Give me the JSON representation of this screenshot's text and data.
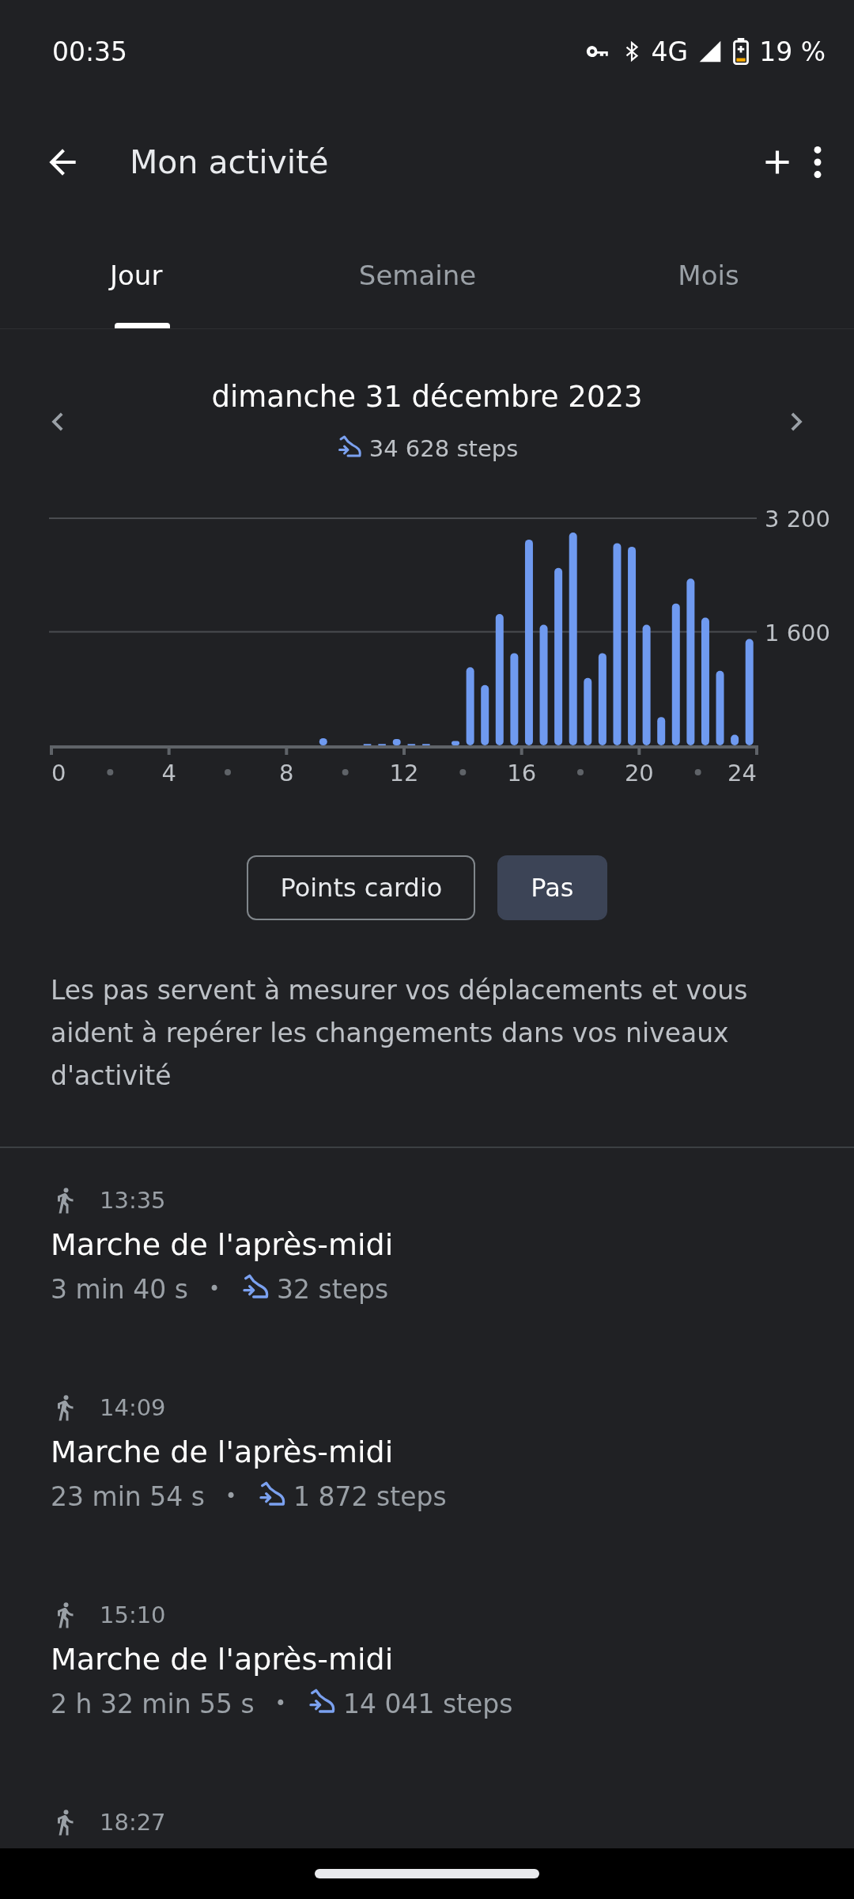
{
  "status_bar": {
    "time": "00:35",
    "network": "4G",
    "battery": "19 %"
  },
  "app_bar": {
    "title": "Mon activité"
  },
  "tabs": [
    {
      "label": "Jour",
      "selected": true
    },
    {
      "label": "Semaine",
      "selected": false
    },
    {
      "label": "Mois",
      "selected": false
    }
  ],
  "day": {
    "date": "dimanche 31 décembre 2023",
    "steps": "34 628 steps"
  },
  "chart_data": {
    "type": "bar",
    "x": [
      0.25,
      0.75,
      1.25,
      1.75,
      2.25,
      2.75,
      3.25,
      3.75,
      4.25,
      4.75,
      5.25,
      5.75,
      6.25,
      6.75,
      7.25,
      7.75,
      8.25,
      8.75,
      9.25,
      9.75,
      10.25,
      10.75,
      11.25,
      11.75,
      12.25,
      12.75,
      13.25,
      13.75,
      14.25,
      14.75,
      15.25,
      15.75,
      16.25,
      16.75,
      17.25,
      17.75,
      18.25,
      18.75,
      19.25,
      19.75,
      20.25,
      20.75,
      21.25,
      21.75,
      22.25,
      22.75,
      23.25,
      23.75
    ],
    "values": [
      0,
      0,
      0,
      0,
      0,
      0,
      0,
      0,
      0,
      0,
      0,
      0,
      0,
      0,
      0,
      0,
      0,
      0,
      100,
      0,
      0,
      20,
      20,
      90,
      20,
      20,
      0,
      60,
      1100,
      850,
      1850,
      1300,
      2900,
      1700,
      2500,
      3000,
      950,
      1300,
      2850,
      2800,
      1700,
      400,
      2000,
      2350,
      1800,
      1050,
      150,
      1500
    ],
    "xlim": [
      0,
      24
    ],
    "ylim": [
      0,
      3200
    ],
    "xticks": [
      0,
      4,
      8,
      12,
      16,
      20,
      24
    ],
    "yticks": [
      {
        "value": 1600,
        "label": "1 600"
      },
      {
        "value": 3200,
        "label": "3 200"
      }
    ]
  },
  "metric_toggle": [
    {
      "label": "Points cardio",
      "selected": false
    },
    {
      "label": "Pas",
      "selected": true
    }
  ],
  "description": "Les pas servent à mesurer vos déplacements et vous aident à repérer les changements dans vos niveaux d'activité",
  "activities": [
    {
      "time": "13:35",
      "title": "Marche de l'après-midi",
      "duration": "3 min 40 s",
      "separator": "•",
      "steps": "32 steps"
    },
    {
      "time": "14:09",
      "title": "Marche de l'après-midi",
      "duration": "23 min 54 s",
      "separator": "•",
      "steps": "1 872 steps"
    },
    {
      "time": "15:10",
      "title": "Marche de l'après-midi",
      "duration": "2 h 32 min 55 s",
      "separator": "•",
      "steps": "14 041 steps"
    },
    {
      "time": "18:27"
    }
  ]
}
